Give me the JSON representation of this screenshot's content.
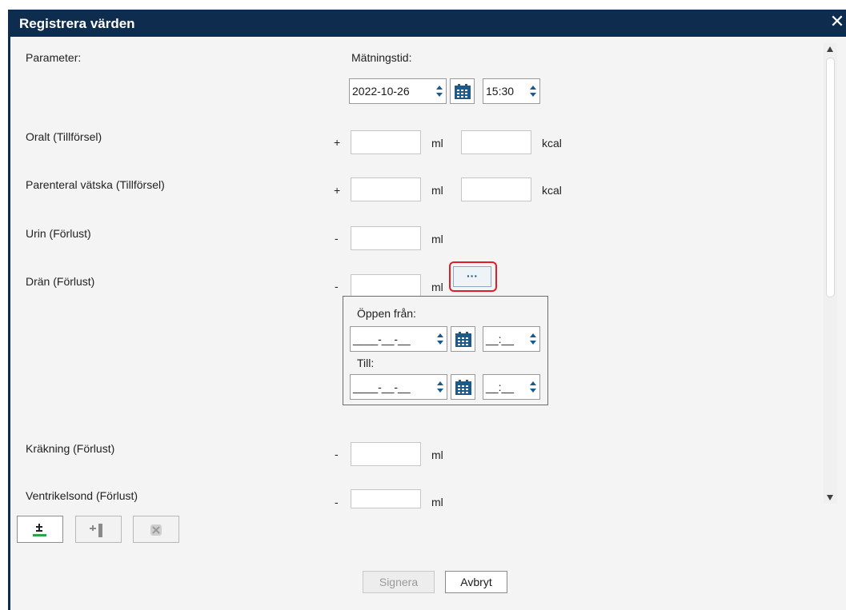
{
  "dialog": {
    "title": "Registrera värden",
    "close_glyph": "✕"
  },
  "header": {
    "parameter_label": "Parameter:",
    "measurement_time_label": "Mätningstid:",
    "date_value": "2022-10-26",
    "time_value": "15:30"
  },
  "rows": [
    {
      "label": "Oralt (Tillförsel)",
      "sign": "+",
      "unit1": "ml",
      "unit2": "kcal"
    },
    {
      "label": "Parenteral vätska (Tillförsel)",
      "sign": "+",
      "unit1": "ml",
      "unit2": "kcal"
    },
    {
      "label": "Urin (Förlust)",
      "sign": "-",
      "unit1": "ml"
    },
    {
      "label": "Drän (Förlust)",
      "sign": "-",
      "unit1": "ml",
      "more_button": "···"
    },
    {
      "label": "Kräkning (Förlust)",
      "sign": "-",
      "unit1": "ml"
    },
    {
      "label": "Ventrikelsond (Förlust)",
      "sign": "-",
      "unit1": "ml"
    }
  ],
  "period": {
    "open_from_label": "Öppen från:",
    "to_label": "Till:",
    "date_placeholder": "____-__-__",
    "time_placeholder": "__:__"
  },
  "toolbar": {
    "add_icon": "plus-minus-icon",
    "add_column_icon": "add-column-icon",
    "remove_icon": "remove-icon"
  },
  "buttons": {
    "sign": "Signera",
    "cancel": "Avbryt"
  },
  "colors": {
    "title_bar": "#0e2d4e",
    "accent": "#1b5a8a",
    "highlight": "#e01e2a"
  }
}
